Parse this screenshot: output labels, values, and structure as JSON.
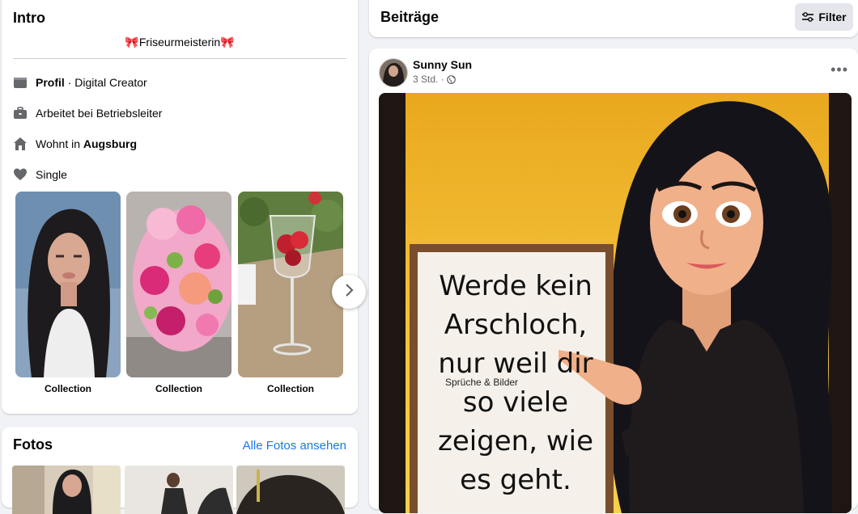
{
  "intro": {
    "title": "Intro",
    "bio": "🎀Friseurmeisterin🎀",
    "rows": [
      {
        "icon": "briefcase-profile-icon",
        "bold": "Profil",
        "text": " · Digital Creator"
      },
      {
        "icon": "work-bag-icon",
        "text": "Arbeitet bei Betriebsleiter"
      },
      {
        "icon": "home-icon",
        "prefix": "Wohnt in ",
        "bold": "Augsburg"
      },
      {
        "icon": "heart-icon",
        "text": "Single"
      }
    ],
    "collections": [
      {
        "label": "Collection"
      },
      {
        "label": "Collection"
      },
      {
        "label": "Collection"
      }
    ]
  },
  "fotos": {
    "title": "Fotos",
    "link": "Alle Fotos ansehen"
  },
  "beitraege": {
    "title": "Beiträge",
    "filter_label": "Filter"
  },
  "post": {
    "author": "Sunny Sun",
    "time": "3 Std. ·",
    "image_text": [
      "Werde kein",
      "Arschloch,",
      "nur weil dir",
      "so viele",
      "zeigen, wie",
      "es geht."
    ],
    "watermark": "Sprüche & Bilder"
  },
  "colors": {
    "accent": "#1877f2",
    "background": "#f0f2f5",
    "secondary_text": "#65676b"
  }
}
